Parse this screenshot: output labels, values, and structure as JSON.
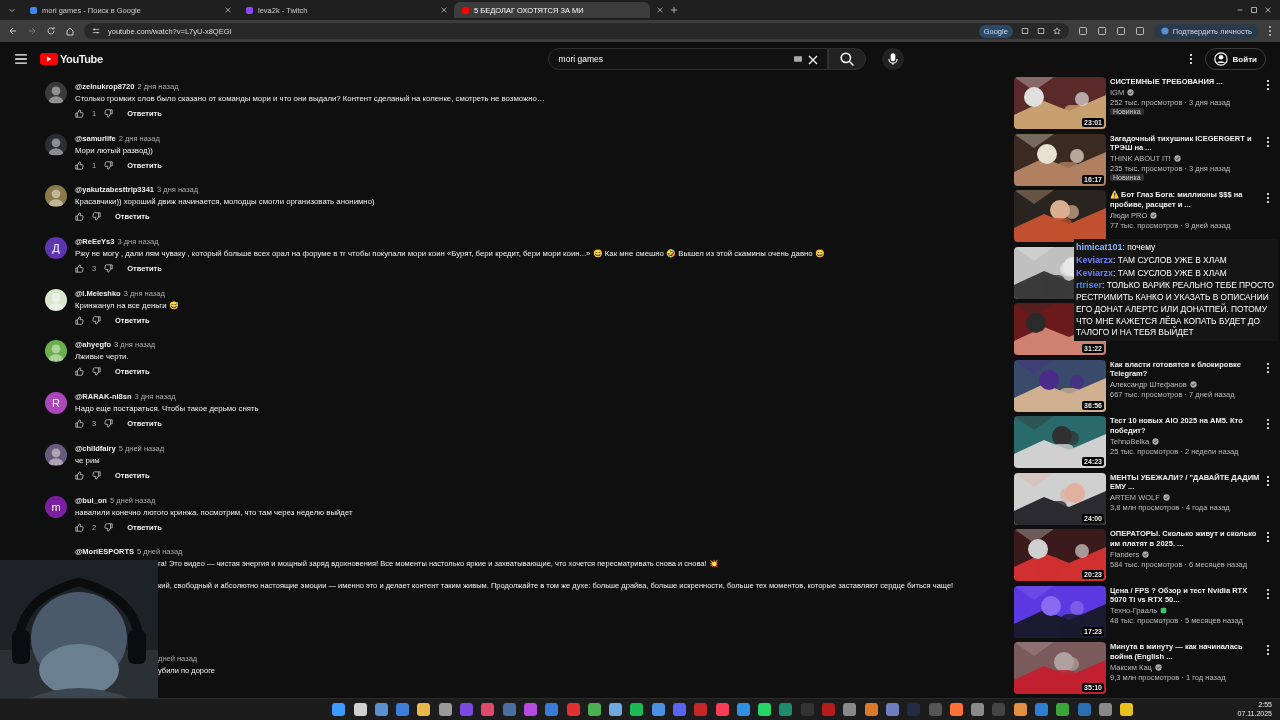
{
  "browser": {
    "tabs": [
      {
        "title": "mori games - Поиск в Google",
        "selected": false,
        "color": "#4285f4"
      },
      {
        "title": "leva2k - Twitch",
        "selected": false,
        "color": "#9146ff"
      },
      {
        "title": "5 БЕДОЛАГ ОХОТЯТСЯ ЗА МИ",
        "selected": true,
        "color": "#ff0000"
      }
    ],
    "address": "youtube.com/watch?v=L7yU-x8QEGI",
    "account_chip": "Google",
    "verify_button": "Подтвердить личность"
  },
  "header": {
    "logo": "YouTube",
    "search": {
      "value": "mori games"
    },
    "sign_in": "Войти"
  },
  "comments": [
    {
      "kind": "full",
      "author": "@zelnukrop8720",
      "time": "2 дня назад",
      "text": "Столько громких слов было сказано от команды мори и что они выдали? Контент сделаный на коленке, смотреть не возможно…",
      "likes": "1",
      "reply": "Ответить",
      "avatar": {
        "color": "#3a3a3a"
      }
    },
    {
      "kind": "full",
      "author": "@samurlife",
      "time": "2 дня назад",
      "text": "Мори лютый развод))",
      "likes": "1",
      "reply": "Ответить",
      "avatar": {
        "color": "#2b2e33"
      }
    },
    {
      "kind": "full",
      "author": "@yakutzabesttrip3341",
      "time": "3 дня назад",
      "text": "Красавчики)) хороший движ начинается, молодцы смогли организовать анонимно)",
      "reply": "Ответить",
      "avatar": {
        "color": "#8a7a4a"
      }
    },
    {
      "kind": "full",
      "author": "@ReEeYs3",
      "time": "3 дня назад",
      "text": "Ржу не могу , дали лям чуваку , который больше всех орал на форуме в тг чтобы покупали мори коин «Бурят, бери кредит, бери мори коин...» 😄 Как мне смешно 🤣 Вышел из этой скамины очень давно 😄",
      "likes": "3",
      "reply": "Ответить",
      "avatar": {
        "color": "#5e35b1",
        "letter": "Д"
      }
    },
    {
      "kind": "full",
      "author": "@I.Meleshko",
      "time": "3 дня назад",
      "text": "Кринжанул на все деньги 😅",
      "reply": "Ответить",
      "avatar": {
        "color": "#d8e8d0"
      }
    },
    {
      "kind": "full",
      "author": "@ahyegfo",
      "time": "3 дня назад",
      "text": "Лживые черти.",
      "reply": "Ответить",
      "avatar": {
        "color": "#6ab04c"
      }
    },
    {
      "kind": "full",
      "author": "@RARAK-nl8sn",
      "time": "3 дня назад",
      "text": "Надо еще постараться. Чтобы такое дерьмо снять",
      "likes": "3",
      "reply": "Ответить",
      "avatar": {
        "color": "#ab47bc",
        "letter": "R"
      }
    },
    {
      "kind": "full",
      "author": "@childfairy",
      "time": "5 дней назад",
      "text": "че рим",
      "reply": "Ответить",
      "avatar": {
        "color": "#6a5a7a"
      }
    },
    {
      "kind": "full",
      "author": "@bul_on",
      "time": "5 дней назад",
      "text": "навалили конечно лютого кринжа. посмотрим, что там через неделю выйдет",
      "likes": "2",
      "reply": "Ответить",
      "avatar": {
        "color": "#7b1fa2",
        "letter": "m"
      }
    },
    {
      "kind": "covered",
      "author": "@MoriESPORTS",
      "time": "5 дней назад",
      "lines": [
        "га! Это видео — чистая энергия и мощный заряд вдохновения! Все моменты настолько яркие и захватывающие, что хочется пересматривать снова и снова! 💥",
        "кий, свободный и абсолютно настоящие эмоции — именно это и делает контент таким живым. Продолжайте в том же духе: больше драйва, больше искренности, больше тех моментов, которые заставляют сердце биться чаще!"
      ]
    },
    {
      "kind": "covered",
      "time": "дней назад",
      "lines": [
        "убили по дороге"
      ]
    }
  ],
  "sidebar": [
    {
      "kind": "video",
      "title": "СИСТЕМНЫЕ ТРЕБОВАНИЯ ...",
      "channel": "IGM",
      "verified": true,
      "meta": "252 тыс. просмотров · 3 дня назад",
      "badge": "Новинка",
      "duration": "23:01"
    },
    {
      "kind": "video",
      "title": "Загадочный тихушник ICEGERGERT и ТРЭШ на ...",
      "channel": "THINK ABOUT IT!",
      "verified": true,
      "meta": "235 тыс. просмотров · 3 дня назад",
      "badge": "Новинка",
      "duration": "16:17"
    },
    {
      "kind": "video",
      "title": "⚠️ Бот Глаз Бога: миллионы $$$ на пробиве, расцвет и ...",
      "channel": "Люди PRO",
      "verified": true,
      "meta": "77 тыс. просмотров · 9 дней назад"
    },
    {
      "kind": "covered"
    },
    {
      "kind": "covered",
      "duration": "31:22"
    },
    {
      "kind": "video",
      "title": "Как власти готовятся к блокировке Telegram?",
      "channel": "Александр Штефанов",
      "verified": true,
      "meta": "667 тыс. просмотров · 7 дней назад",
      "duration": "36:56"
    },
    {
      "kind": "video",
      "title": "Тест 10 новых AIO 2025 на AM5. Кто победит?",
      "channel": "TehnoBelka",
      "verified": true,
      "meta": "25 тыс. просмотров · 2 недели назад",
      "duration": "24:23"
    },
    {
      "kind": "video",
      "title": "МЕНТЫ УБЕЖАЛИ? / \"ДАВАЙТЕ ДАДИМ ЕМУ ...",
      "channel": "ARTEM WOLF",
      "verified": true,
      "meta": "3,8 млн просмотров · 4 года назад",
      "duration": "24:00"
    },
    {
      "kind": "video",
      "title": "ОПЕРАТОРЫ. Сколько живут и сколько им платят в 2025. ...",
      "channel": "Flanders",
      "verified": true,
      "meta": "584 тыс. просмотров · 6 месяцев назад",
      "duration": "20:23"
    },
    {
      "kind": "video",
      "title": "Цена / FPS ? Обзор и тест Nvidia RTX 5070 Ti vs RTX 50...",
      "channel": "Техно-Грааль",
      "verified": false,
      "meta": "48 тыс. просмотров · 5 месяцев назад",
      "duration": "17:23"
    },
    {
      "kind": "video",
      "title": "Минута в минуту — как начиналась война (English ...",
      "channel": "Максим Кац",
      "verified": true,
      "meta": "9,3 млн просмотров · 1 год назад",
      "duration": "35:10"
    }
  ],
  "chat": [
    {
      "user": "himicat101",
      "text": ": почему",
      "color": "#8ab4ff"
    },
    {
      "user": "Keviarzx",
      "text": ": ТАМ СУСЛОВ УЖЕ В ХЛАМ",
      "color": "#6f7dff"
    },
    {
      "user": "Keviarzx",
      "text": ": ТАМ СУСЛОВ УЖЕ В ХЛАМ",
      "color": "#6f7dff"
    },
    {
      "user": "rtriser",
      "text": ": ТОЛЬКО ВАРИК РЕАЛЬНО ТЕБЕ ПРОСТО РЕСТРИМИТЬ КАНКО И УКАЗАТЬ В ОПИСАНИИ ЕГО ДОНАТ АЛЕРТС ИЛИ ДОНАТПЕЙ. ПОТОМУ ЧТО МНЕ КАЖЕТСЯ ЛЁВА КОПАТЬ БУДЕТ ДО ТАЛОГО И НА ТЕБЯ ВЫЙДЕТ",
      "color": "#4a8cff"
    }
  ],
  "taskbar": {
    "apps": [
      {
        "color": "#3d9bff"
      },
      {
        "color": "#d0d0d0"
      },
      {
        "color": "#5a8fd0"
      },
      {
        "color": "#3b7dd8"
      },
      {
        "color": "#e8b84a"
      },
      {
        "color": "#9a9a9a"
      },
      {
        "color": "#7a4adf"
      },
      {
        "color": "#e04a6a"
      },
      {
        "color": "#4a6fa0"
      },
      {
        "color": "#b44ae0"
      },
      {
        "color": "#3a7bd5"
      },
      {
        "color": "#e03030"
      },
      {
        "color": "#4caf50"
      },
      {
        "color": "#6fa8dc"
      },
      {
        "color": "#1db954"
      },
      {
        "color": "#4a90e2"
      },
      {
        "color": "#5865f2"
      },
      {
        "color": "#c62828"
      },
      {
        "color": "#fa3c55"
      },
      {
        "color": "#2f8fe0"
      },
      {
        "color": "#25d366"
      },
      {
        "color": "#1e8a6e"
      },
      {
        "color": "#333333"
      },
      {
        "color": "#b71c1c"
      },
      {
        "color": "#888888"
      },
      {
        "color": "#d87a2a"
      },
      {
        "color": "#6f7dbf"
      },
      {
        "color": "#222a44"
      },
      {
        "color": "#555555"
      },
      {
        "color": "#ff7139"
      },
      {
        "color": "#8a8a8a"
      },
      {
        "color": "#444444"
      },
      {
        "color": "#e09040"
      },
      {
        "color": "#2d7dd2"
      },
      {
        "color": "#3aa63a"
      },
      {
        "color": "#2a6fb0"
      },
      {
        "color": "#888888"
      },
      {
        "color": "#e8c020"
      }
    ],
    "time": "2:55",
    "date": "07.11.2025"
  }
}
